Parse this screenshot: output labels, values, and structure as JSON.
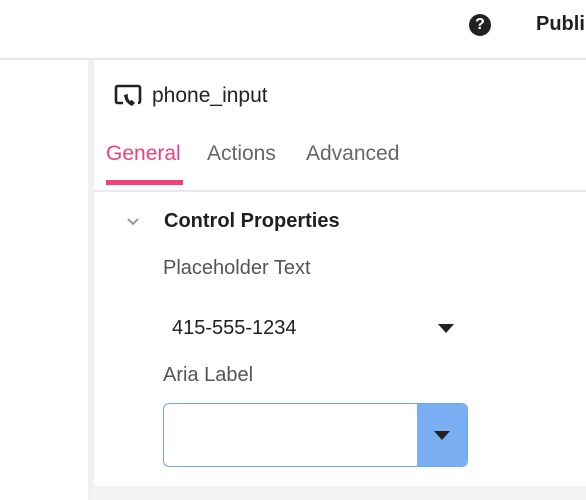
{
  "topbar": {
    "help_icon": "question-circle-icon",
    "publish_label": "Publi"
  },
  "component": {
    "icon": "phone-frame-icon",
    "name": "phone_input"
  },
  "tabs": [
    {
      "label": "General",
      "active": true
    },
    {
      "label": "Actions",
      "active": false
    },
    {
      "label": "Advanced",
      "active": false
    }
  ],
  "section": {
    "title": "Control Properties",
    "expanded": true
  },
  "fields": {
    "placeholder_label": "Placeholder Text",
    "placeholder_value": "415-555-1234",
    "aria_label": "Aria Label",
    "aria_value": ""
  },
  "colors": {
    "accent": "#f0417a",
    "focus_border": "#6fa8f2",
    "dropdown_button": "#7aaef3"
  }
}
